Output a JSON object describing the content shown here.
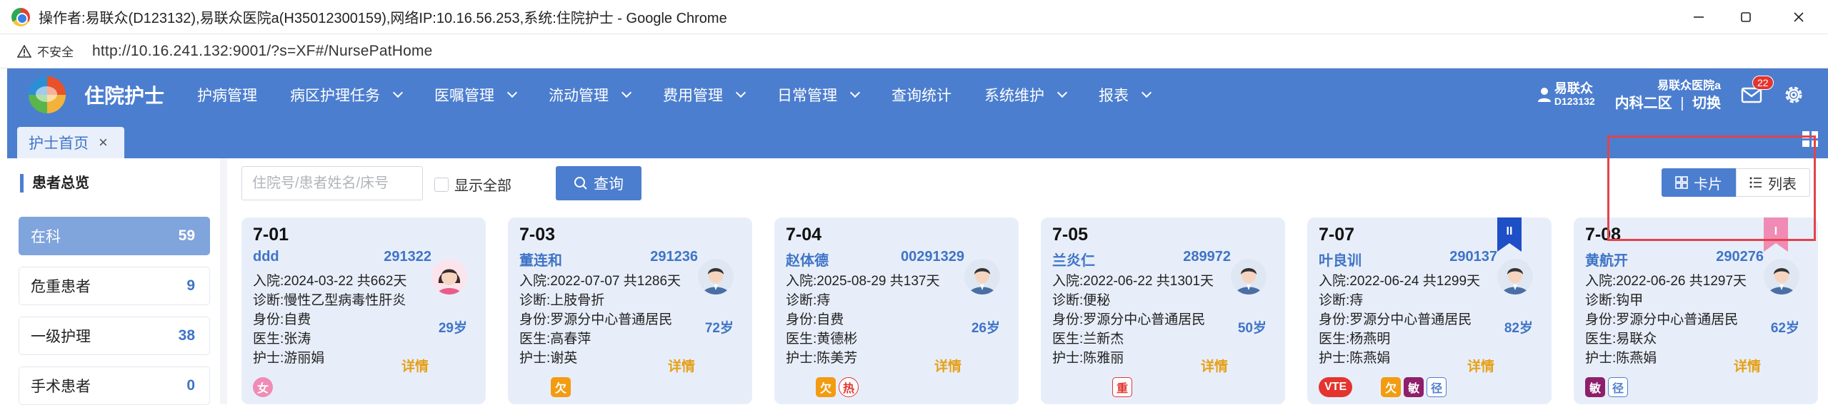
{
  "browser": {
    "window_title": "操作者:易联众(D123132),易联众医院a(H35012300159),网络IP:10.16.56.253,系统:住院护士 - Google Chrome",
    "security_label": "不安全",
    "url": "http://10.16.241.132:9001/?s=XF#/NursePatHome"
  },
  "header": {
    "app_name": "住院护士",
    "nav": [
      "护病管理",
      "病区护理任务",
      "医嘱管理",
      "流动管理",
      "费用管理",
      "日常管理",
      "查询统计",
      "系统维护",
      "报表"
    ],
    "user_name": "易联众",
    "user_id": "D123132",
    "hospital": "易联众医院a",
    "ward": "内科二区",
    "separator": "|",
    "switch_label": "切换",
    "mail_count": "22"
  },
  "tabs": [
    {
      "label": "护士首页",
      "close": "×"
    }
  ],
  "sidebar": {
    "title": "患者总览",
    "items": [
      {
        "label": "在科",
        "count": "59"
      },
      {
        "label": "危重患者",
        "count": "9"
      },
      {
        "label": "一级护理",
        "count": "38"
      },
      {
        "label": "手术患者",
        "count": "0"
      }
    ]
  },
  "toolbar": {
    "search_placeholder": "住院号/患者姓名/床号",
    "show_all": "显示全部",
    "query": "查询",
    "view_card": "卡片",
    "view_list": "列表"
  },
  "labels": {
    "admit": "入院:",
    "diag": "诊断:",
    "identity": "身份:",
    "doctor": "医生:",
    "nurse": "护士:",
    "detail": "详情"
  },
  "colors": {
    "primary": "#4c7ecf",
    "card_bg": "#e8eef9",
    "accent_orange": "#e5a019",
    "red_box": "#e3434a"
  },
  "patients": [
    {
      "bed": "7-01",
      "name": "ddd",
      "id": "291322",
      "admit": "2024-03-22 共662天",
      "diag": "慢性乙型病毒性肝炎",
      "identity": "自费",
      "doctor": "张涛",
      "nurse": "游丽娟",
      "age": "29岁",
      "avatar": "female",
      "tags": [
        "女"
      ]
    },
    {
      "bed": "7-03",
      "name": "董连和",
      "id": "291236",
      "admit": "2022-07-07 共1286天",
      "diag": "上肢骨折",
      "identity": "罗源分中心普通居民",
      "doctor": "高春萍",
      "nurse": "谢英",
      "age": "72岁",
      "avatar": "male",
      "tags": [
        "欠"
      ]
    },
    {
      "bed": "7-04",
      "name": "赵体德",
      "id": "00291329",
      "admit": "2025-08-29 共137天",
      "diag": "痔",
      "identity": "自费",
      "doctor": "黄德彬",
      "nurse": "陈美芳",
      "age": "26岁",
      "avatar": "male",
      "tags": [
        "欠",
        "热"
      ]
    },
    {
      "bed": "7-05",
      "name": "兰炎仁",
      "id": "289972",
      "admit": "2022-06-22 共1301天",
      "diag": "便秘",
      "identity": "罗源分中心普通居民",
      "doctor": "兰新杰",
      "nurse": "陈雅丽",
      "age": "50岁",
      "avatar": "male",
      "tags": [
        "重"
      ]
    },
    {
      "bed": "7-07",
      "name": "叶良训",
      "id": "290137",
      "admit": "2022-06-24 共1299天",
      "diag": "痔",
      "identity": "罗源分中心普通居民",
      "doctor": "杨燕明",
      "nurse": "陈燕娟",
      "age": "82岁",
      "avatar": "male",
      "ribbon": "II",
      "tags": [
        "VTE",
        "欠",
        "敏",
        "径"
      ]
    },
    {
      "bed": "7-08",
      "name": "黄航开",
      "id": "290276",
      "admit": "2022-06-26 共1297天",
      "diag": "钩甲",
      "identity": "罗源分中心普通居民",
      "doctor": "易联众",
      "nurse": "陈燕娟",
      "age": "62岁",
      "avatar": "male",
      "ribbon": "I",
      "tags": [
        "敏",
        "径"
      ]
    }
  ]
}
